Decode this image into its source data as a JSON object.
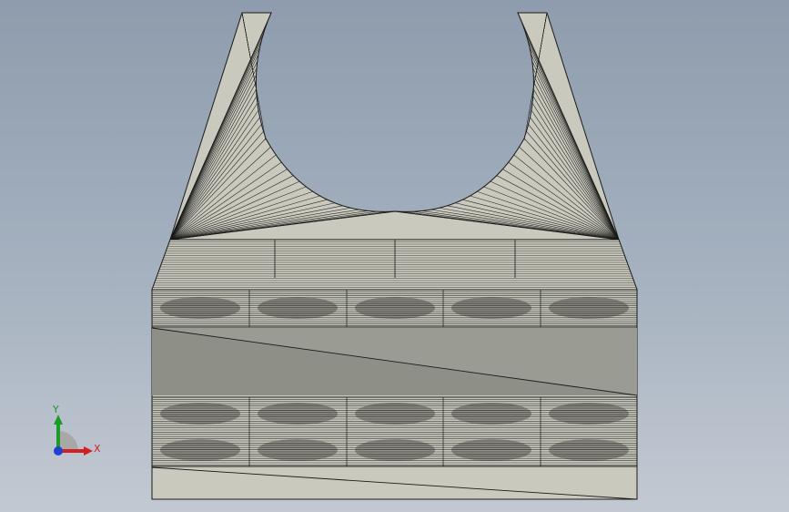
{
  "view": {
    "background_top": "#8e9cad",
    "background_bottom": "#c3c9d2",
    "part_color": "#c9c9bd",
    "part_shadow_color": "#8e8f86",
    "edge_color": "#1a1a1a"
  },
  "triad": {
    "x_label": "X",
    "y_label": "Y",
    "x_color": "#d02020",
    "y_color": "#1d9b2a",
    "z_color": "#2040d0"
  }
}
